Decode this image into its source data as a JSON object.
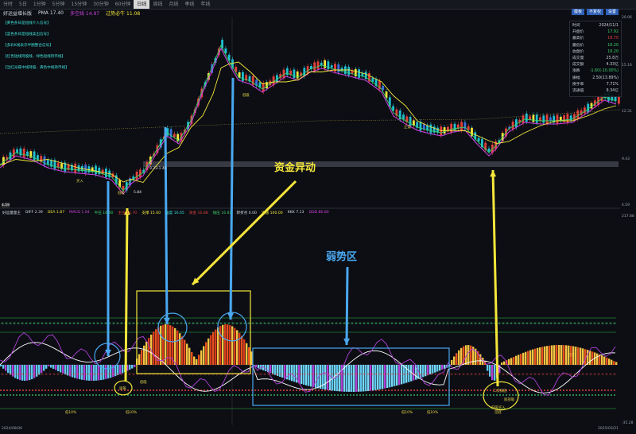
{
  "tabs": [
    "分时",
    "5日",
    "1分钟",
    "5分钟",
    "15分钟",
    "30分钟",
    "60分钟",
    "日线",
    "周线",
    "月线",
    "季线",
    "年线"
  ],
  "active_tab": "日线",
  "title": {
    "name": "好运益增长版",
    "pma": "PMA 17.40",
    "mid": "多空线 14.97",
    "trend": "过势必牛 11.08"
  },
  "right_buttons": [
    "模板",
    "不复权",
    "设置"
  ],
  "legend_items": [
    "【黄色条日是短线介入信号】",
    "【蓝色条日是短线卖出信号】",
    "【多彩K线表示半圈整合信号】",
    "【红色短线持股线、绿色短线持币线】",
    "【当红光碟中线持股、黄色中线持币线】"
  ],
  "info_panel": [
    {
      "k": "时间",
      "v": "2024/11/1",
      "c": "#d0d4dc"
    },
    {
      "k": "开盘价",
      "v": "17.92",
      "c": "#3ecf6b"
    },
    {
      "k": "最高价",
      "v": "18.70",
      "c": "#e2413b"
    },
    {
      "k": "最低价",
      "v": "16.20",
      "c": "#3ecf6b"
    },
    {
      "k": "收盘价",
      "v": "16.20",
      "c": "#3ecf6b"
    },
    {
      "k": "成交量",
      "v": "25.8万",
      "c": "#d0d4dc"
    },
    {
      "k": "成交额",
      "v": "4.33亿",
      "c": "#d0d4dc"
    },
    {
      "k": "涨跌",
      "v": "-1.60(-10.00%)",
      "c": "#3ecf6b"
    },
    {
      "k": "振幅",
      "v": "2.50(13.89%)",
      "c": "#d0d4dc"
    },
    {
      "k": "换手率",
      "v": "7.71%",
      "c": "#d0d4dc"
    },
    {
      "k": "流通值",
      "v": "9.34亿",
      "c": "#d0d4dc"
    }
  ],
  "price_axis": [
    "20.06",
    "15.16",
    "12.31",
    "9.43",
    "4.59",
    "4.59"
  ],
  "price_labels": {
    "low_left": "4.59",
    "mark1": "5.84",
    "mark2": "9.23-1.40"
  },
  "indicator_bar": [
    "好运量量王",
    "DIFF 2.39",
    "DEA 1.87",
    "MACD 1.04",
    "牛压 16.40",
    "主压 16.70",
    "支撑 15.00",
    "强度 16.65",
    "资金 16.88",
    "抛压 16.81",
    "转折点 0.00",
    "追涨 100.00",
    "KKK 7.13",
    "DDD 86.80"
  ],
  "ind_axis": [
    "217.88",
    "-35.28"
  ],
  "date_left": "2024/08/06",
  "date_right": "2025/03/21",
  "annotations": {
    "capital": "资金异动",
    "weak": "弱势区"
  },
  "small_tags": [
    "低吸",
    "买入",
    "低吸",
    "止盈",
    "吸筹",
    "低10%",
    "低10%",
    "低10%",
    "低10%",
    "二次探底",
    "底部吸",
    "低吸买入",
    "低吸",
    "见顶",
    "见底"
  ],
  "colors": {
    "bg": "#0c0e14",
    "up": "#e2413b",
    "down": "#1fc0d0",
    "yellow": "#f5e63a",
    "blue": "#4aa8f0",
    "purple": "#b040d8"
  }
}
